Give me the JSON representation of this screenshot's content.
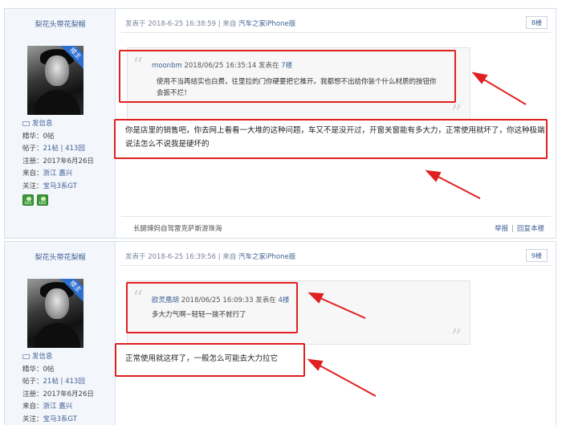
{
  "posts": [
    {
      "username": "梨花头带花梨帽",
      "badge": "楼主",
      "message_label": "发信息",
      "stats": {
        "essence": "精华：0帖",
        "posts_label": "帖子：",
        "posts_value": "21帖 | 413回",
        "registered": "注册：2017年6月26日",
        "from_label": "来自：",
        "from_value": "浙江 嘉兴",
        "follow_label": "关注：",
        "follow_value": "宝马3系GT"
      },
      "levels": [
        "LV1",
        "LV2"
      ],
      "posted_prefix": "发表于 2018-6-25 16:38:59 | 来自",
      "posted_source": "汽车之家iPhone版",
      "floor": "8楼",
      "quote": {
        "name": "moonbm",
        "meta": "2018/06/25 16:35:14 发表在",
        "floor": "7楼",
        "text": "使用不当再结实也白费，往里拉的门你硬要把它推开。我都想不出给你装个什么材质的按钮你会扳不烂！"
      },
      "reply": "你是店里的销售吧，你去网上看看一大堆的这种问题，车又不是没开过，开窗关窗能有多大力，正常使用就坏了，你这种极端说法怎么不说我是硬坏的",
      "signature": "长腿辣妈自驾雷克萨斯游珠海",
      "actions": {
        "report": "举报",
        "reply": "回复本楼"
      }
    },
    {
      "username": "梨花头带花梨帽",
      "badge": "楼主",
      "message_label": "发信息",
      "stats": {
        "essence": "精华：0帖",
        "posts_label": "帖子：",
        "posts_value": "21帖 | 413回",
        "registered": "注册：2017年6月26日",
        "from_label": "来自：",
        "from_value": "浙江 嘉兴",
        "follow_label": "关注：",
        "follow_value": "宝马3系GT"
      },
      "posted_prefix": "发表于 2018-6-25 16:39:56 | 来自",
      "posted_source": "汽车之家iPhone版",
      "floor": "9楼",
      "quote": {
        "name": "欧灵凰胡",
        "meta": "2018/06/25 16:09:33 发表在",
        "floor": "4楼",
        "text": "多大力气啊~轻轻一拨不就行了"
      },
      "reply": "正常使用就这样了，一般怎么可能去大力拉它"
    }
  ],
  "colors": {
    "link": "#3e5f95",
    "annotation": "#e02020",
    "sidebar": "#f3f6fb"
  }
}
